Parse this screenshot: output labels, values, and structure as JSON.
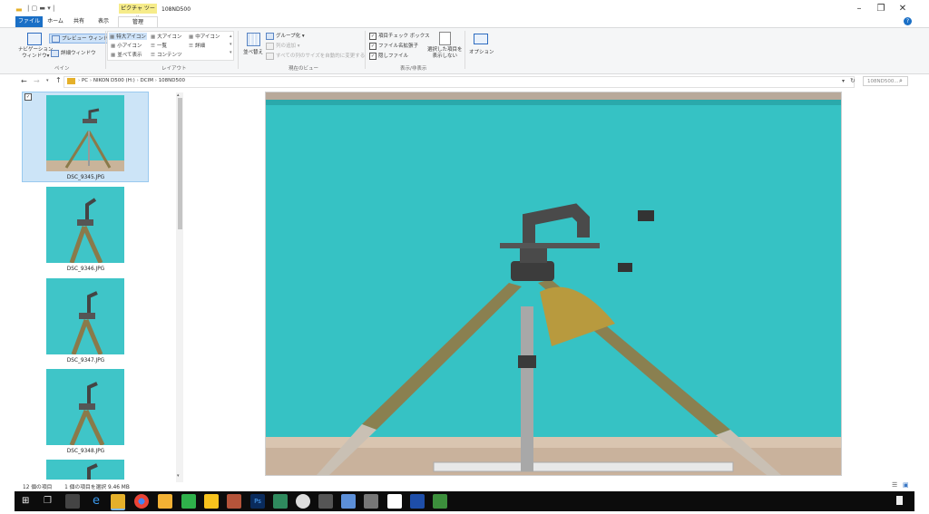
{
  "titlebar": {
    "context_label": "ピクチャ ツール",
    "window_title": "108ND500",
    "minimize": "–",
    "maximize": "❐",
    "close": "✕"
  },
  "tabs": {
    "file": "ファイル",
    "home": "ホーム",
    "share": "共有",
    "view": "表示",
    "manage": "管理"
  },
  "ribbon": {
    "nav_pane": "ナビゲーション\nウィンドウ▾",
    "preview_pane": "プレビュー ウィンドウ",
    "details_pane": "詳細ウィンドウ",
    "group_pane": "ペイン",
    "layout_items": [
      "特大アイコン",
      "大アイコン",
      "中アイコン",
      "小アイコン",
      "一覧",
      "詳細",
      "並べて表示",
      "コンテンツ"
    ],
    "group_layout": "レイアウト",
    "sort_by": "並べ替え",
    "group_by": "グループ化 ▾",
    "add_columns": "列の追加 ▾",
    "size_columns": "すべての列のサイズを自動的に変更する",
    "group_current_view": "現在のビュー",
    "checkboxes": "項目チェック ボックス",
    "extensions": "ファイル名拡張子",
    "hidden": "隠しファイル",
    "hide_selected": "選択した項目を\n表示しない",
    "group_show_hide": "表示/非表示",
    "options": "オプション"
  },
  "address": {
    "path": [
      "PC",
      "NIKON D500 (H:)",
      "DCIM",
      "108ND500"
    ],
    "search_placeholder": "108ND500..."
  },
  "files": [
    {
      "name": "DSC_9345.JPG",
      "selected": true
    },
    {
      "name": "DSC_9346.JPG",
      "selected": false
    },
    {
      "name": "DSC_9347.JPG",
      "selected": false
    },
    {
      "name": "DSC_9348.JPG",
      "selected": false
    }
  ],
  "status": {
    "count": "12 個の項目",
    "selection": "1 個の項目を選択 9.46 MB"
  },
  "colors": {
    "accent": "#1a6fc6",
    "selection": "#cce4f7",
    "teal_backdrop": "#36c2c4"
  }
}
